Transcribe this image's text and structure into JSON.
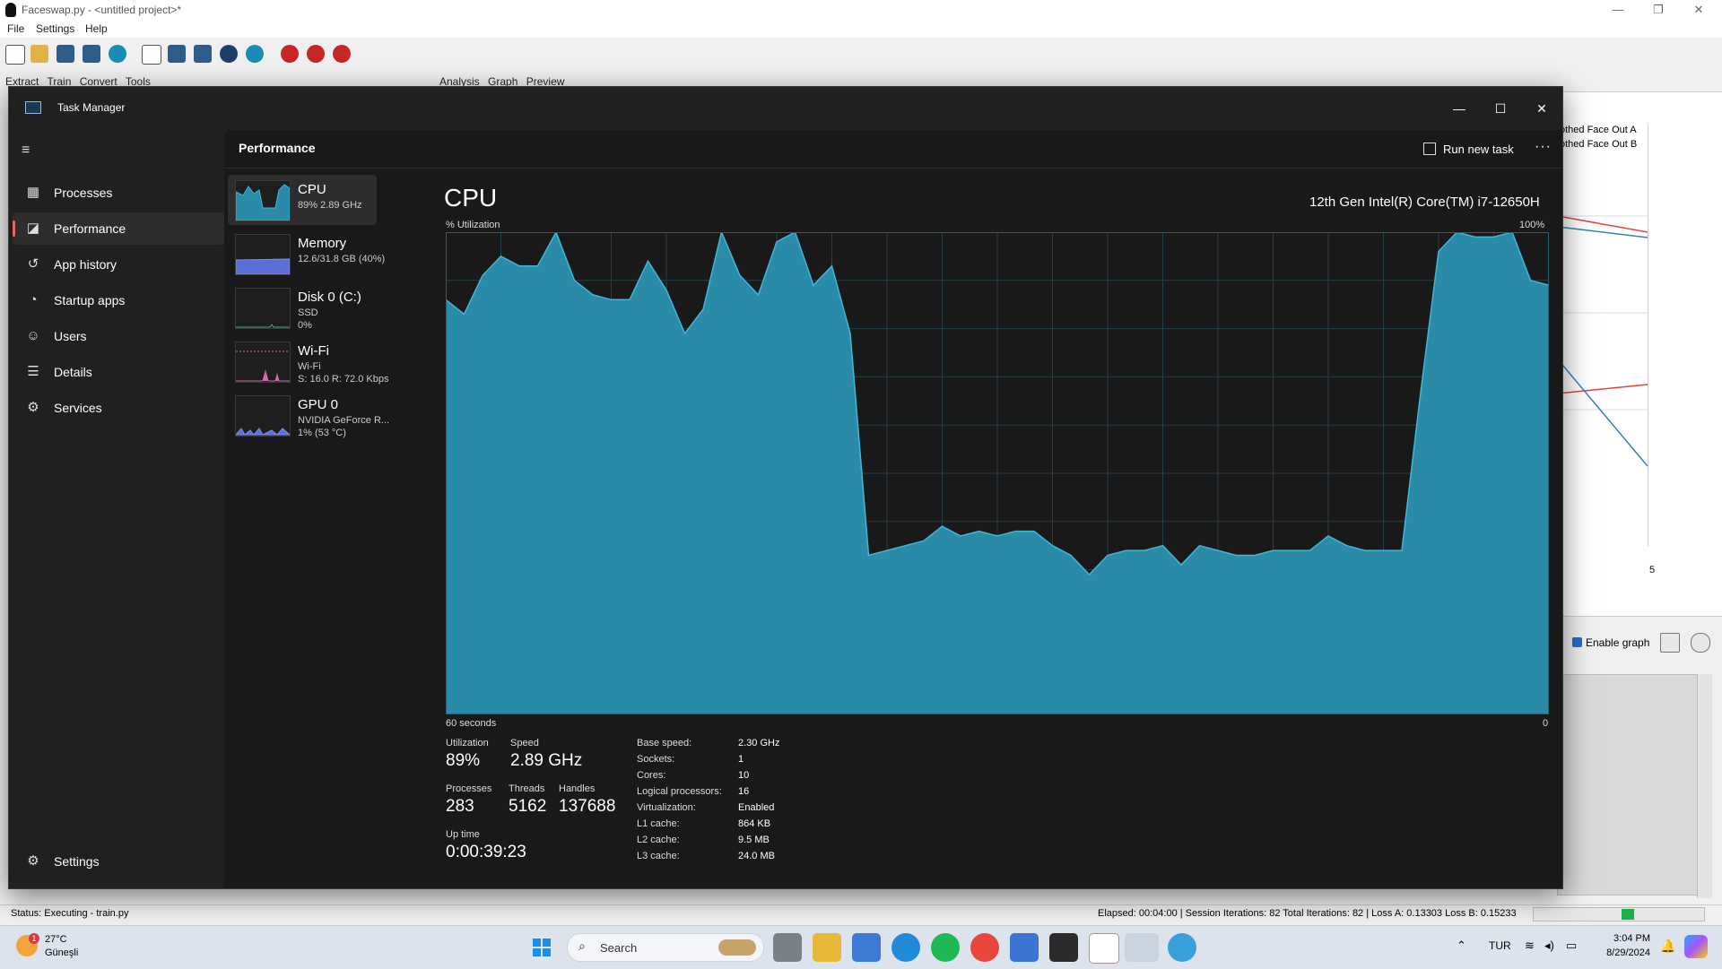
{
  "faceswap": {
    "title": "Faceswap.py - <untitled project>*",
    "menu": [
      "File",
      "Settings",
      "Help"
    ],
    "tabs_left": [
      "Extract",
      "Train",
      "Convert",
      "Tools"
    ],
    "tabs_right": [
      "Analysis",
      "Graph",
      "Preview"
    ],
    "legend_a": "othed Face Out A",
    "legend_b": "othed Face Out B",
    "graph_tick": "5",
    "enable_graph_label": "Enable graph",
    "status_left": "Status: Executing - train.py",
    "status_right": "Elapsed: 00:04:00 | Session Iterations: 82  Total Iterations: 82 | Loss A: 0.13303  Loss B: 0.15233",
    "line_colors": {
      "a": "#e0463c",
      "b": "#3a7ebf"
    }
  },
  "taskmgr": {
    "title": "Task Manager",
    "nav": [
      {
        "label": "Processes",
        "icon": "processes-icon"
      },
      {
        "label": "Performance",
        "icon": "performance-icon"
      },
      {
        "label": "App history",
        "icon": "app-history-icon"
      },
      {
        "label": "Startup apps",
        "icon": "startup-icon"
      },
      {
        "label": "Users",
        "icon": "users-icon"
      },
      {
        "label": "Details",
        "icon": "details-icon"
      },
      {
        "label": "Services",
        "icon": "services-icon"
      }
    ],
    "settings_label": "Settings",
    "page_title": "Performance",
    "run_new_task": "Run new task",
    "resources": [
      {
        "name": "CPU",
        "line1": "89%  2.89 GHz",
        "line2": ""
      },
      {
        "name": "Memory",
        "line1": "12.6/31.8 GB (40%)",
        "line2": ""
      },
      {
        "name": "Disk 0 (C:)",
        "line1": "SSD",
        "line2": "0%"
      },
      {
        "name": "Wi-Fi",
        "line1": "Wi-Fi",
        "line2": "S: 16.0  R: 72.0 Kbps"
      },
      {
        "name": "GPU 0",
        "line1": "NVIDIA GeForce R...",
        "line2": "1% (53 °C)"
      }
    ],
    "cpu": {
      "title": "CPU",
      "model": "12th Gen Intel(R) Core(TM) i7-12650H",
      "util_label": "% Utilization",
      "util_max": "100%",
      "time_label": "60 seconds",
      "time_zero": "0",
      "stats": {
        "utilization_label": "Utilization",
        "utilization": "89%",
        "speed_label": "Speed",
        "speed": "2.89 GHz",
        "processes_label": "Processes",
        "processes": "283",
        "threads_label": "Threads",
        "threads": "5162",
        "handles_label": "Handles",
        "handles": "137688",
        "uptime_label": "Up time",
        "uptime": "0:00:39:23"
      },
      "specs": [
        {
          "label": "Base speed:",
          "value": "2.30 GHz"
        },
        {
          "label": "Sockets:",
          "value": "1"
        },
        {
          "label": "Cores:",
          "value": "10"
        },
        {
          "label": "Logical processors:",
          "value": "16"
        },
        {
          "label": "Virtualization:",
          "value": "Enabled"
        },
        {
          "label": "L1 cache:",
          "value": "864 KB"
        },
        {
          "label": "L2 cache:",
          "value": "9.5 MB"
        },
        {
          "label": "L3 cache:",
          "value": "24.0 MB"
        }
      ]
    },
    "colors": {
      "cpu": "#2a8ba8",
      "cpu_line": "#41b6d8",
      "memory": "#5a6fd6",
      "wifi": "#d36aa9",
      "accent": "#e3686c"
    }
  },
  "chart_data": {
    "type": "area",
    "title": "CPU",
    "xlabel": "60 seconds",
    "ylabel": "% Utilization",
    "xlim": [
      60,
      0
    ],
    "ylim": [
      0,
      100
    ],
    "series": [
      {
        "name": "",
        "x": [
          60,
          59,
          58,
          57,
          56,
          55,
          54,
          53,
          52,
          51,
          50,
          49,
          48,
          47,
          46,
          45,
          44,
          43,
          42,
          41,
          40,
          39,
          38,
          37,
          36,
          35,
          34,
          33,
          32,
          31,
          30,
          29,
          28,
          27,
          26,
          25,
          24,
          23,
          22,
          21,
          20,
          19,
          18,
          17,
          16,
          15,
          14,
          13,
          12,
          11,
          10,
          9,
          8,
          7,
          6,
          5,
          4,
          3,
          2,
          1,
          0
        ],
        "values": [
          86,
          83,
          91,
          95,
          93,
          93,
          100,
          90,
          87,
          86,
          86,
          94,
          88,
          79,
          84,
          100,
          91,
          87,
          98,
          100,
          89,
          93,
          79,
          33,
          34,
          35,
          36,
          39,
          37,
          38,
          37,
          38,
          38,
          35,
          33,
          29,
          33,
          34,
          34,
          35,
          31,
          35,
          34,
          33,
          33,
          34,
          34,
          34,
          37,
          35,
          34,
          34,
          34,
          66,
          96,
          100,
          99,
          99,
          100,
          90,
          89
        ],
        "color": "#2a8ba8"
      }
    ]
  },
  "taskbar": {
    "weather_temp": "27°C",
    "weather_desc": "Güneşli",
    "weather_badge": "1",
    "search": "Search",
    "lang": "TUR",
    "time": "3:04 PM",
    "date": "8/29/2024"
  }
}
